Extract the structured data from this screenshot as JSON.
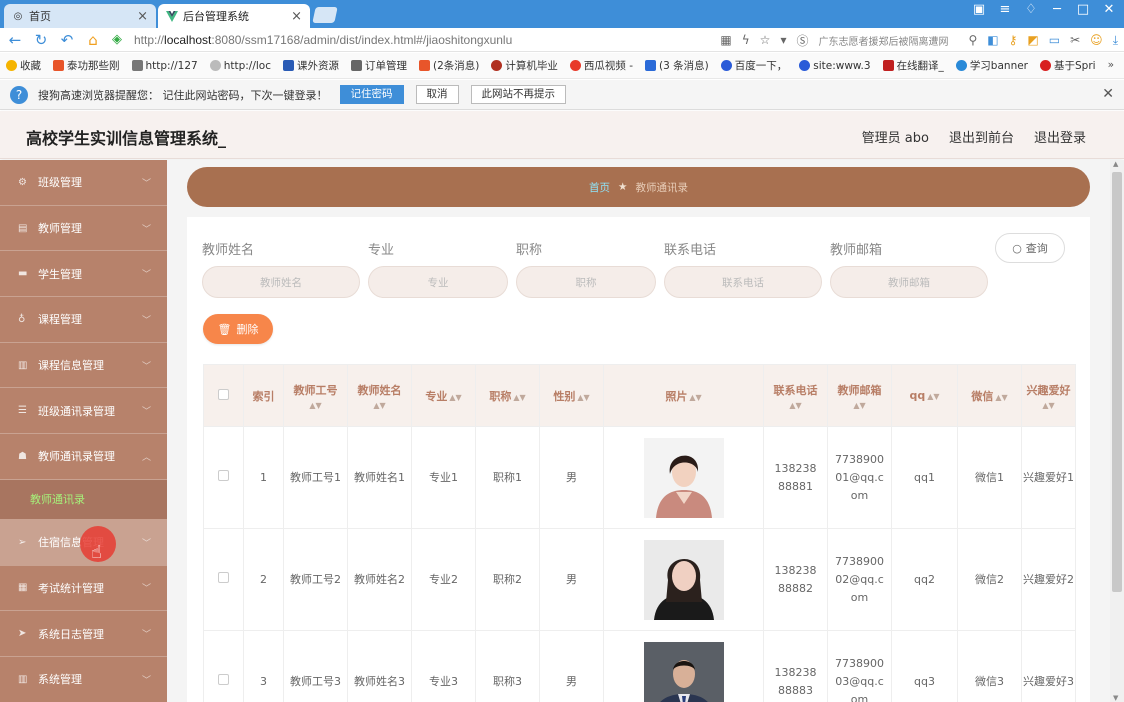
{
  "browser": {
    "tabs": [
      {
        "title": "首页",
        "icon": "globe-icon"
      },
      {
        "title": "后台管理系统",
        "icon": "vue-logo-icon"
      }
    ],
    "url_prefix": "http://",
    "url_host": "localhost",
    "url_rest": ":8080/ssm17168/admin/dist/index.html#/jiaoshitongxunlu",
    "address_hint": "广东志愿者援郑后被隔离遭网",
    "bookmarks": [
      {
        "label": "收藏",
        "color": "#f5b400"
      },
      {
        "label": "泰功那些刚",
        "color": "#e8552a"
      },
      {
        "label": "http://127",
        "color": "#777777"
      },
      {
        "label": "http://loc",
        "color": "#999999"
      },
      {
        "label": "课外资源",
        "color": "#2a5bb5"
      },
      {
        "label": "订单管理",
        "color": "#666666"
      },
      {
        "label": "(2条消息)",
        "color": "#e8552a"
      },
      {
        "label": "计算机毕业",
        "color": "#b03020"
      },
      {
        "label": "西瓜视频 -",
        "color": "#e83a2a"
      },
      {
        "label": "(3 条消息)",
        "color": "#2a6ad8"
      },
      {
        "label": "百度一下，",
        "color": "#2a5bd8"
      },
      {
        "label": "site:www.3",
        "color": "#2a5bd8"
      },
      {
        "label": "在线翻译_",
        "color": "#c02020"
      },
      {
        "label": "学习banner",
        "color": "#2a8ad8"
      },
      {
        "label": "基于Spri",
        "color": "#d82020"
      }
    ],
    "password_banner": {
      "text": "搜狗高速浏览器提醒您：  记住此网站密码，下次一键登录！",
      "remember": "记住密码",
      "cancel": "取消",
      "never": "此网站不再提示"
    }
  },
  "header": {
    "title": "高校学生实训信息管理系统_",
    "admin": "管理员 abo",
    "back_front": "退出到前台",
    "logout": "退出登录"
  },
  "sidebar": {
    "items": [
      {
        "label": "班级管理"
      },
      {
        "label": "教师管理"
      },
      {
        "label": "学生管理"
      },
      {
        "label": "课程管理"
      },
      {
        "label": "课程信息管理"
      },
      {
        "label": "班级通讯录管理"
      },
      {
        "label": "教师通讯录管理"
      },
      {
        "label": "住宿信息管理"
      },
      {
        "label": "考试统计管理"
      },
      {
        "label": "系统日志管理"
      },
      {
        "label": "系统管理"
      }
    ],
    "submenu_active": "教师通讯录"
  },
  "breadcrumb": {
    "home": "首页",
    "current": "教师通讯录"
  },
  "search": {
    "fields": [
      {
        "label": "教师姓名",
        "placeholder": "教师姓名"
      },
      {
        "label": "专业",
        "placeholder": "专业"
      },
      {
        "label": "职称",
        "placeholder": "职称"
      },
      {
        "label": "联系电话",
        "placeholder": "联系电话"
      },
      {
        "label": "教师邮箱",
        "placeholder": "教师邮箱"
      }
    ],
    "query_button": "查询"
  },
  "actions": {
    "delete_button": "删除"
  },
  "table": {
    "columns": [
      "索引",
      "教师工号",
      "教师姓名",
      "专业",
      "职称",
      "性别",
      "照片",
      "联系电话",
      "教师邮箱",
      "qq",
      "微信",
      "兴趣爱好"
    ],
    "rows": [
      {
        "index": "1",
        "gonghao": "教师工号1",
        "name": "教师姓名1",
        "major": "专业1",
        "title": "职称1",
        "gender": "男",
        "phone": "13823888881",
        "email": "773890001@qq.com",
        "qq": "qq1",
        "wechat": "微信1",
        "hobby": "兴趣爱好1"
      },
      {
        "index": "2",
        "gonghao": "教师工号2",
        "name": "教师姓名2",
        "major": "专业2",
        "title": "职称2",
        "gender": "男",
        "phone": "13823888882",
        "email": "773890002@qq.com",
        "qq": "qq2",
        "wechat": "微信2",
        "hobby": "兴趣爱好2"
      },
      {
        "index": "3",
        "gonghao": "教师工号3",
        "name": "教师姓名3",
        "major": "专业3",
        "title": "职称3",
        "gender": "男",
        "phone": "13823888883",
        "email": "773890003@qq.com",
        "qq": "qq3",
        "wechat": "微信3",
        "hobby": "兴趣爱好3"
      }
    ]
  },
  "colors": {
    "sidebar_bg": "#b7826b",
    "breadcrumb_bg": "#a87050",
    "accent_orange": "#f7864a",
    "active_submenu": "#a6f07a",
    "tab_bar": "#3e8ed8"
  }
}
